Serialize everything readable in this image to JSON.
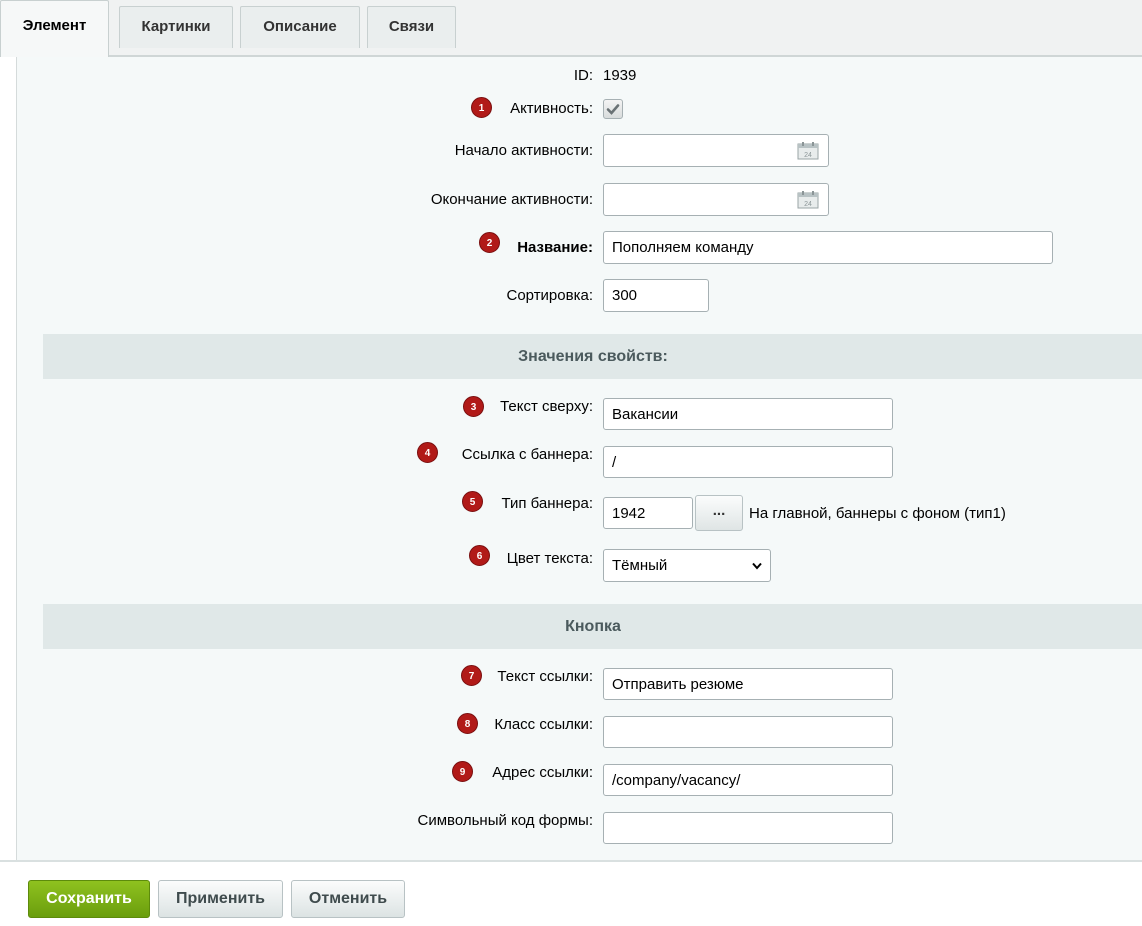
{
  "tabs": [
    {
      "label": "Элемент",
      "active": true
    },
    {
      "label": "Картинки"
    },
    {
      "label": "Описание"
    },
    {
      "label": "Связи"
    }
  ],
  "fields": {
    "id": {
      "label": "ID:",
      "value": "1939"
    },
    "active": {
      "label": "Активность:",
      "marker": "1",
      "checked": true
    },
    "date_from": {
      "label": "Начало активности:",
      "value": ""
    },
    "date_to": {
      "label": "Окончание активности:",
      "value": ""
    },
    "name": {
      "label": "Название:",
      "marker": "2",
      "value": "Пополняем команду"
    },
    "sort": {
      "label": "Сортировка:",
      "value": "300"
    }
  },
  "sections": {
    "props": "Значения свойств:",
    "button": "Кнопка"
  },
  "props": {
    "text_top": {
      "label": "Текст сверху:",
      "marker": "3",
      "value": "Вакансии"
    },
    "banner_link": {
      "label": "Ссылка с баннера:",
      "marker": "4",
      "value": "/"
    },
    "banner_type": {
      "label": "Тип баннера:",
      "marker": "5",
      "value": "1942",
      "picker_label": "...",
      "description": "На главной, баннеры с фоном (тип1)"
    },
    "text_color": {
      "label": "Цвет текста:",
      "marker": "6",
      "value": "Тёмный"
    }
  },
  "button_props": {
    "link_text": {
      "label": "Текст ссылки:",
      "marker": "7",
      "value": "Отправить резюме"
    },
    "link_class": {
      "label": "Класс ссылки:",
      "marker": "8",
      "value": ""
    },
    "link_url": {
      "label": "Адрес ссылки:",
      "marker": "9",
      "value": "/company/vacancy/"
    },
    "form_code": {
      "label": "Символьный код формы:",
      "value": ""
    }
  },
  "footer": {
    "save": "Сохранить",
    "apply": "Применить",
    "cancel": "Отменить"
  },
  "colors": {
    "accent_green": "#7ab317",
    "marker_red": "#b11a18",
    "section_bg": "#e0e8e8"
  }
}
